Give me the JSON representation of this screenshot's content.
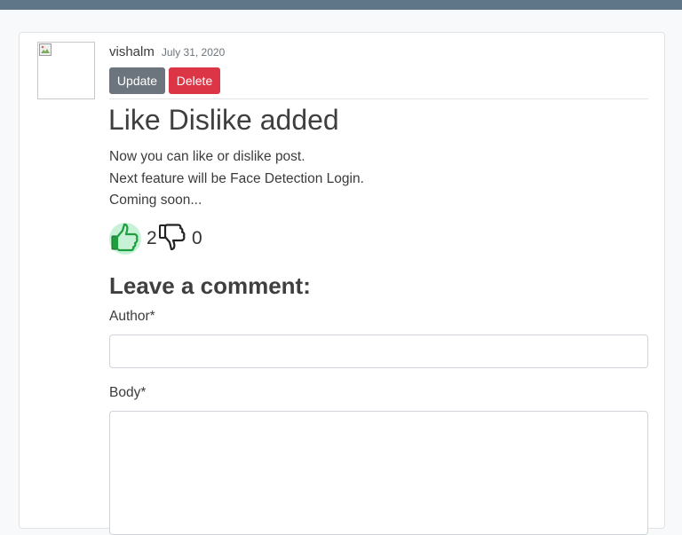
{
  "post": {
    "author": "vishalm",
    "date": "July 31, 2020",
    "title": "Like Dislike added",
    "body_lines": [
      "Now you can like or dislike post.",
      "Next feature will be Face Detection Login.",
      "Coming soon..."
    ],
    "actions": {
      "update_label": "Update",
      "delete_label": "Delete"
    },
    "reactions": {
      "likes": "2",
      "dislikes": "0",
      "like_icon": "thumbs-up-icon",
      "dislike_icon": "thumbs-down-icon",
      "like_active": true,
      "like_color": "#1e9e3c"
    }
  },
  "comment_form": {
    "heading": "Leave a comment:",
    "author_label": "Author*",
    "author_value": "",
    "body_label": "Body*",
    "body_value": ""
  },
  "colors": {
    "topbar": "#5f7588",
    "update_button": "#6c757d",
    "delete_button": "#dc3545",
    "like_glow": "#c8f2d8"
  }
}
